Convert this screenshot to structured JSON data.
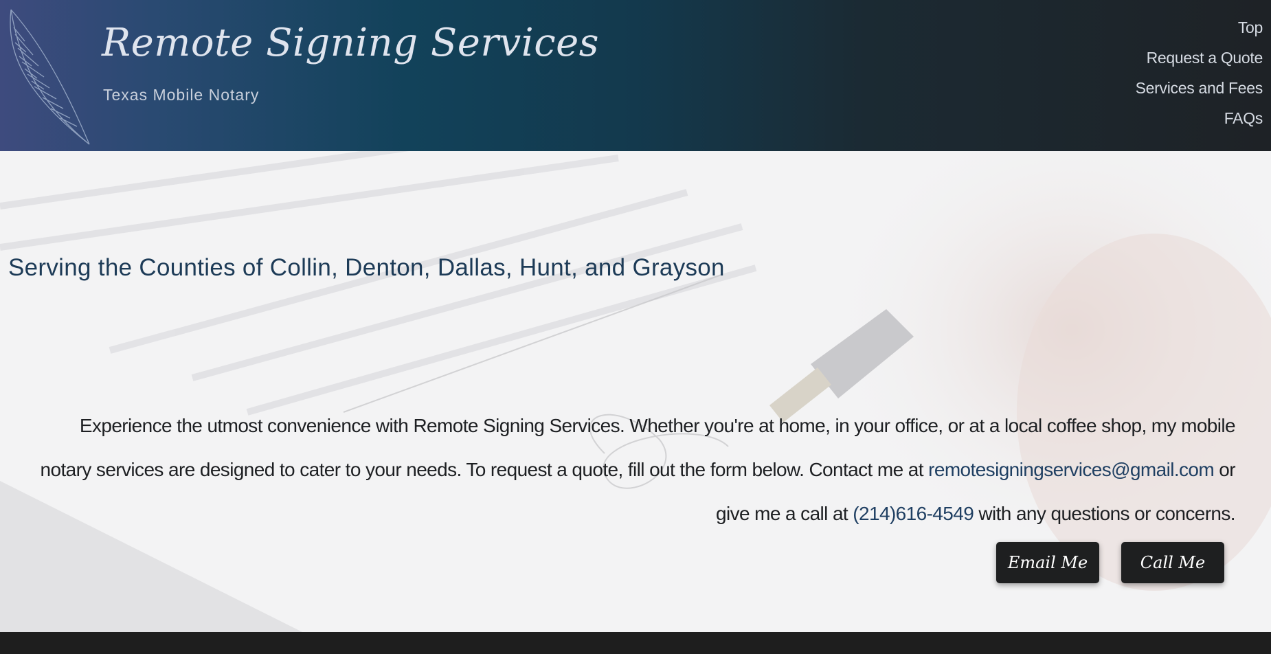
{
  "brand": {
    "title": "Remote Signing Services",
    "subtitle": "Texas Mobile Notary",
    "logo_icon": "quill-feather-icon"
  },
  "nav": {
    "items": [
      {
        "label": "Top"
      },
      {
        "label": "Request a Quote"
      },
      {
        "label": "Services and Fees"
      },
      {
        "label": "FAQs"
      }
    ]
  },
  "hero": {
    "heading": "Serving the Counties of Collin, Denton, Dallas, Hunt, and Grayson",
    "intro_before_email": "Experience the utmost convenience with Remote Signing Services. Whether you're at home, in your office, or at a local coffee shop, my mobile notary services are designed to cater to your needs. To request a quote, fill out the form below. Contact me at ",
    "email": "remotesigningservices@gmail.com",
    "intro_between": " or give me a call at ",
    "phone": "(214)616-4549",
    "intro_after_phone": " with any questions or concerns.",
    "email_button": "Email Me",
    "call_button": "Call Me"
  },
  "colors": {
    "header_start": "#3e4b7e",
    "header_end": "#1e2226",
    "link": "#1f3f62",
    "heading": "#1d3b57",
    "button_bg": "#1e1f20"
  }
}
